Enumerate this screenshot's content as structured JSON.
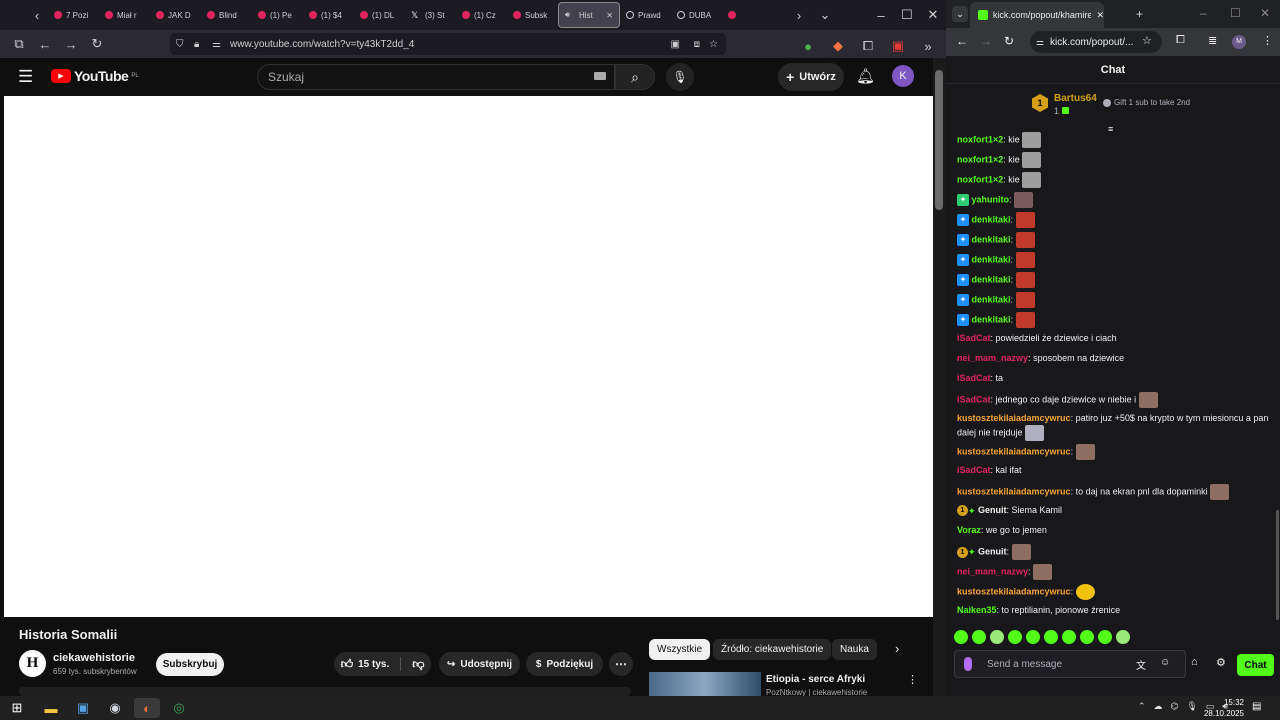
{
  "firefox": {
    "tabs": [
      "7 Pozi",
      "Miał r",
      "JAK D",
      "Blind",
      "(1) Pe",
      "(1) $4",
      "(1) DL",
      "(3) St",
      "(1) Cz",
      "Subsk",
      "Hist",
      "Prawd",
      "DUBA",
      ""
    ],
    "active_tab_index": 10,
    "url": "www.youtube.com/watch?v=ty43kT2dd_4"
  },
  "youtube": {
    "logo": "YouTube",
    "region": "PL",
    "search_placeholder": "Szukaj",
    "create_label": "Utwórz",
    "avatar_letter": "K",
    "video_title": "Historia Somalii",
    "channel_name": "ciekawehistorie",
    "channel_subs": "659 tys. subskrybentów",
    "channel_initial": "H",
    "subscribe_label": "Subskrybuj",
    "likes": "15 tys.",
    "share_label": "Udostępnij",
    "thanks_label": "Podziękuj",
    "chips": [
      "Wszystkie",
      "Źródło: ciekawehistorie",
      "Nauka"
    ],
    "related_title": "Etiopia - serce Afryki",
    "related_sub": "PozNtkowy | ciekawehistorie"
  },
  "kick": {
    "tab_title": "kick.com/popout/khamires/cha",
    "url": "kick.com/popout/...",
    "chat_title": "Chat",
    "pinned_user": "Bartus64",
    "pinned_rank": "1",
    "pinned_count": "1",
    "pinned_gift": "Gift 1 sub to take 2nd",
    "input_placeholder": "Send a message",
    "chat_button": "Chat",
    "messages": [
      {
        "user": "noxfort1×2",
        "text": "kie",
        "color": "#53fc18"
      },
      {
        "user": "noxfort1×2",
        "text": "kie",
        "color": "#53fc18"
      },
      {
        "user": "noxfort1×2",
        "text": "kie",
        "color": "#53fc18"
      },
      {
        "user": "yahunito",
        "text": "",
        "color": "#53fc18"
      },
      {
        "user": "denkitaki",
        "text": "",
        "color": "#53fc18"
      },
      {
        "user": "denkitaki",
        "text": "",
        "color": "#53fc18"
      },
      {
        "user": "denkitaki",
        "text": "",
        "color": "#53fc18"
      },
      {
        "user": "denkitaki",
        "text": "",
        "color": "#53fc18"
      },
      {
        "user": "denkitaki",
        "text": "",
        "color": "#53fc18"
      },
      {
        "user": "denkitaki",
        "text": "",
        "color": "#53fc18"
      },
      {
        "user": "iSadCat",
        "text": "powiedzieli że dziewice i ciach",
        "color": "#e0245e"
      },
      {
        "user": "nei_mam_nazwy",
        "text": "sposobem na dziewice",
        "color": "#e0245e"
      },
      {
        "user": "iSadCat",
        "text": "ta",
        "color": "#e0245e"
      },
      {
        "user": "iSadCat",
        "text": "jednego co daje dziewice w niebie i",
        "color": "#e0245e"
      },
      {
        "user": "kustosztekilaiadamcywruc",
        "text": "patiro juz +50$ na krypto w tym miesioncu a pan dalej nie trejduje",
        "color": "#f7a433"
      },
      {
        "user": "kustosztekilaiadamcywruc",
        "text": "",
        "color": "#f7a433"
      },
      {
        "user": "iSadCat",
        "text": "kal ifat",
        "color": "#e0245e"
      },
      {
        "user": "kustosztekilaiadamcywruc",
        "text": "to daj na ekran pnl dla dopaminki",
        "color": "#f7a433"
      },
      {
        "user": "Genuit",
        "text": "Siema Kamil",
        "color": "#f1f1f1"
      },
      {
        "user": "Voraz",
        "text": "we go to jemen",
        "color": "#53fc18"
      },
      {
        "user": "Genuit",
        "text": "",
        "color": "#f1f1f1"
      },
      {
        "user": "nei_mam_nazwy",
        "text": "",
        "color": "#e0245e"
      },
      {
        "user": "kustosztekilaiadamcywruc",
        "text": "",
        "color": "#f7a433"
      },
      {
        "user": "Naiken35",
        "text": "to reptilianin, pionowe źrenice",
        "color": "#53fc18"
      }
    ]
  },
  "taskbar": {
    "time": "15:32",
    "date": "28.10.2025"
  }
}
